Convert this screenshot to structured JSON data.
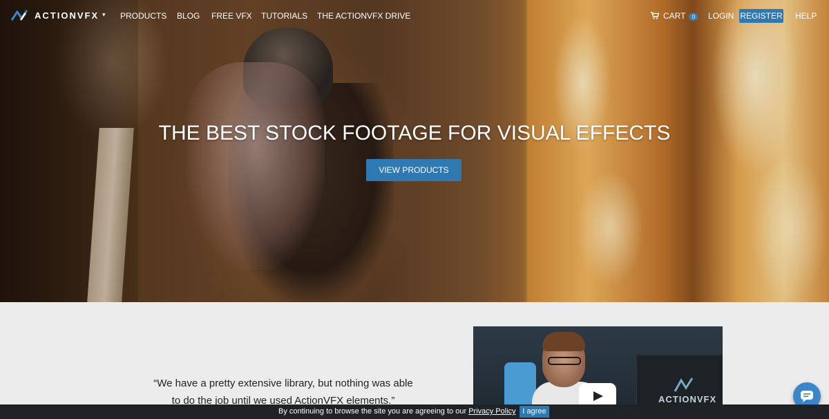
{
  "nav": {
    "logo_text": "ACTIONVFX",
    "logo_caret": "▾",
    "links": [
      "PRODUCTS",
      "BLOG",
      "FREE VFX",
      "TUTORIALS",
      "THE ACTIONVFX DRIVE"
    ],
    "cart_label": "CART",
    "cart_count": "0",
    "login_label": "LOGIN",
    "register_label": "REGISTER",
    "help_label": "HELP"
  },
  "hero": {
    "title": "THE BEST STOCK FOOTAGE FOR VISUAL EFFECTS",
    "cta_label": "VIEW PRODUCTS"
  },
  "testimonial": {
    "quote_line1": "“We have a pretty extensive library, but nothing was able",
    "quote_line2": "to do the job until we used ActionVFX elements.”"
  },
  "video": {
    "brand_text": "ACTIONVFX",
    "play_icon": "play-icon"
  },
  "cookie_bar": {
    "text": "By continuing to browse the site you are agreeing to our",
    "link_label": "Privacy Policy",
    "agree_label": "I agree"
  },
  "colors": {
    "accent": "#2f79b2",
    "cookie_bg": "#1f2326",
    "section_bg": "#ececec"
  }
}
